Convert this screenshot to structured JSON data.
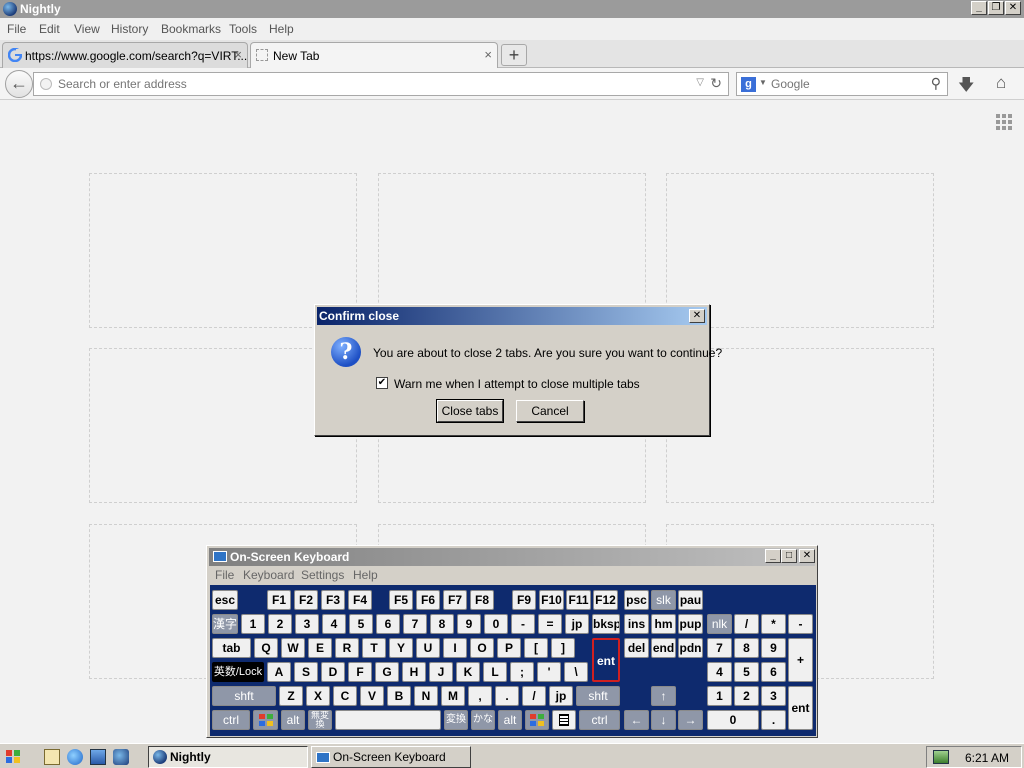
{
  "window": {
    "title": "Nightly"
  },
  "menubar": {
    "items": [
      "File",
      "Edit",
      "View",
      "History",
      "Bookmarks",
      "Tools",
      "Help"
    ]
  },
  "tabs": [
    {
      "label": "https://www.google.com/search?q=VIRT...",
      "active": false
    },
    {
      "label": "New Tab",
      "active": true
    }
  ],
  "navbar": {
    "url_placeholder": "Search or enter address",
    "search_engine": "Google"
  },
  "dialog": {
    "title": "Confirm close",
    "message": "You are about to close 2 tabs. Are you sure you want to continue?",
    "checkbox_label": "Warn me when I attempt to close multiple tabs",
    "checkbox_checked": true,
    "primary_button": "Close tabs",
    "secondary_button": "Cancel"
  },
  "osk": {
    "title": "On-Screen Keyboard",
    "menu": [
      "File",
      "Keyboard",
      "Settings",
      "Help"
    ],
    "keys": {
      "esc": "esc",
      "f1": "F1",
      "f2": "F2",
      "f3": "F3",
      "f4": "F4",
      "f5": "F5",
      "f6": "F6",
      "f7": "F7",
      "f8": "F8",
      "f9": "F9",
      "f10": "F10",
      "f11": "F11",
      "f12": "F12",
      "psc": "psc",
      "slk": "slk",
      "pau": "pau",
      "kanji": "漢字",
      "n1": "1",
      "n2": "2",
      "n3": "3",
      "n4": "4",
      "n5": "5",
      "n6": "6",
      "n7": "7",
      "n8": "8",
      "n9": "9",
      "n0": "0",
      "minus": "-",
      "equal": "=",
      "jp": "jp",
      "bksp": "bksp",
      "ins": "ins",
      "hm": "hm",
      "pup": "pup",
      "nlk": "nlk",
      "kp_div": "/",
      "kp_mul": "*",
      "kp_sub": "-",
      "tab": "tab",
      "q": "Q",
      "w": "W",
      "e": "E",
      "r": "R",
      "t": "T",
      "y": "Y",
      "u": "U",
      "i": "I",
      "o": "O",
      "p": "P",
      "lbr": "[",
      "rbr": "]",
      "ent": "ent",
      "del": "del",
      "end": "end",
      "pdn": "pdn",
      "kp7": "7",
      "kp8": "8",
      "kp9": "9",
      "kp_add": "+",
      "eisu": "英数/Lock",
      "a": "A",
      "s": "S",
      "d": "D",
      "f": "F",
      "g": "G",
      "h": "H",
      "j": "J",
      "k": "K",
      "l": "L",
      "semi": ";",
      "quote": "'",
      "bslash": "\\",
      "kp4": "4",
      "kp5": "5",
      "kp6": "6",
      "lshift": "shft",
      "z": "Z",
      "x": "X",
      "c": "C",
      "v": "V",
      "b": "B",
      "n": "N",
      "m": "M",
      "comma": ",",
      "period": ".",
      "slash": "/",
      "jp2": "jp",
      "rshift": "shft",
      "up": "↑",
      "kp1": "1",
      "kp2": "2",
      "kp3": "3",
      "kp_ent": "ent",
      "lctrl": "ctrl",
      "lalt": "alt",
      "muhenkan": "無変換",
      "henkan": "変換",
      "kana": "かな",
      "ralt": "alt",
      "rctrl": "ctrl",
      "left": "←",
      "down": "↓",
      "right": "→",
      "kp0": "0",
      "kp_dot": "."
    }
  },
  "taskbar": {
    "tasks": [
      {
        "label": "Nightly",
        "active": true
      },
      {
        "label": "On-Screen Keyboard",
        "active": false
      }
    ],
    "clock": "6:21 AM"
  },
  "colors": {
    "dialog_title_start": "#0a246a",
    "dialog_title_end": "#a6caf0",
    "osk_background": "#0e2a6e",
    "enter_key_border": "#d02020"
  }
}
